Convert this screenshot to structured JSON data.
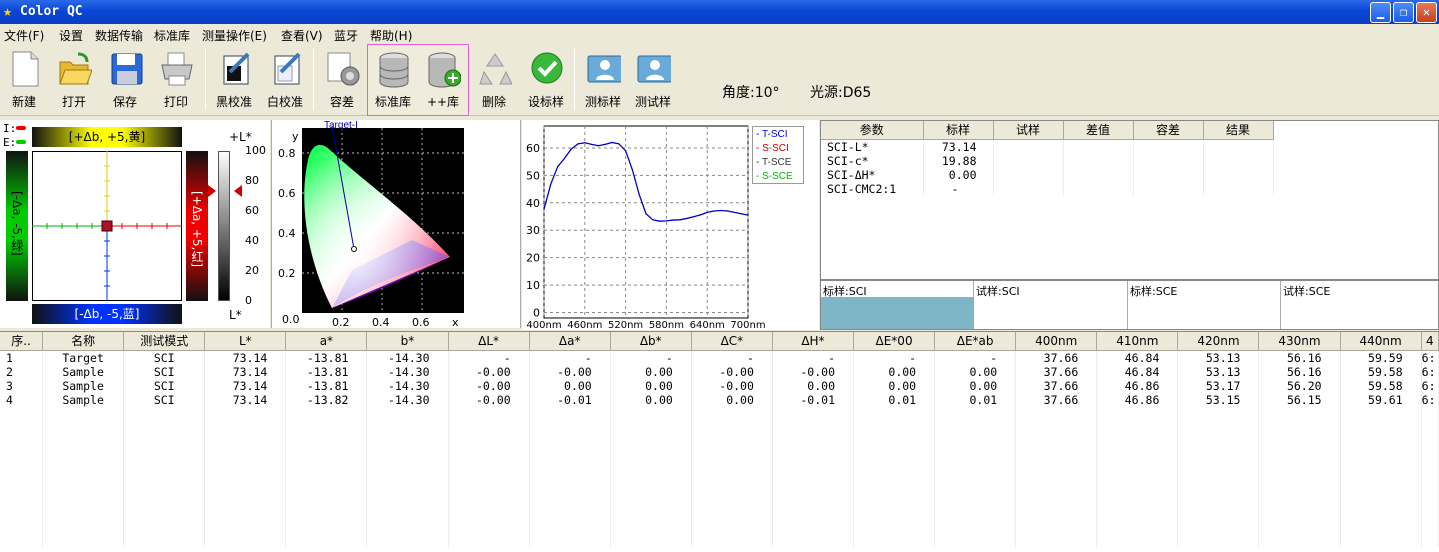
{
  "window": {
    "title": "Color QC"
  },
  "menu": [
    "文件(F)",
    "设置",
    "数据传输",
    "标准库",
    "测量操作(E)",
    "查看(V)",
    "蓝牙",
    "帮助(H)"
  ],
  "toolbar": {
    "new": "新建",
    "open": "打开",
    "save": "保存",
    "print": "打印",
    "black_cal": "黑校准",
    "white_cal": "白校准",
    "tolerance": "容差",
    "std_lib": "标准库",
    "add_lib": "++库",
    "delete": "删除",
    "set_std": "设标样",
    "measure_std": "测标样",
    "measure_trial": "测试样",
    "angle": "角度:10°",
    "light": "光源:D65"
  },
  "ab_panel": {
    "legend_i": "I:",
    "legend_e": "E:",
    "top_label": "[+Δb, +5,黄]",
    "bottom_label": "[-Δb, -5,蓝]",
    "left_label": "[-Δa, -5,绿]",
    "right_label": "[+Δa, +5,红]",
    "l_top": "+L*",
    "l_bottom": "L*",
    "l_ticks": [
      "100",
      "80",
      "60",
      "40",
      "20",
      "0"
    ],
    "marker_l": 73.14
  },
  "cie_panel": {
    "target_label": "Target-I",
    "y_axis": "y",
    "x_axis": "x",
    "y_ticks": [
      "0.8",
      "0.6",
      "0.4",
      "0.2"
    ],
    "x_ticks": [
      "0.0",
      "0.2",
      "0.4",
      "0.6"
    ]
  },
  "spectrum": {
    "legend": [
      {
        "name": "T-SCI",
        "color": "#0000cc"
      },
      {
        "name": "S-SCI",
        "color": "#cc0000"
      },
      {
        "name": "T-SCE",
        "color": "#333333"
      },
      {
        "name": "S-SCE",
        "color": "#00bb00"
      }
    ]
  },
  "chart_data": {
    "type": "line",
    "x": [
      400,
      410,
      420,
      430,
      440,
      450,
      460,
      470,
      480,
      490,
      500,
      510,
      520,
      530,
      540,
      550,
      560,
      570,
      580,
      590,
      600,
      610,
      620,
      630,
      640,
      650,
      660,
      670,
      680,
      690,
      700
    ],
    "series": [
      {
        "name": "T-SCI",
        "values": [
          37.66,
          46.84,
          53.13,
          56.16,
          59.59,
          61.5,
          61.9,
          61.3,
          60.8,
          61.3,
          62.0,
          61.5,
          59.0,
          52.0,
          43.0,
          36.0,
          33.8,
          33.3,
          33.4,
          33.7,
          33.8,
          34.3,
          34.9,
          35.6,
          36.5,
          37.0,
          37.2,
          37.0,
          36.5,
          36.0,
          35.5
        ]
      }
    ],
    "xticks": [
      "400nm",
      "460nm",
      "520nm",
      "580nm",
      "640nm",
      "700nm"
    ],
    "yticks": [
      "0",
      "10",
      "20",
      "30",
      "40",
      "50",
      "60"
    ],
    "ylim": [
      -2,
      68
    ],
    "xlim": [
      400,
      700
    ]
  },
  "result_table": {
    "headers": [
      "参数",
      "标样",
      "试样",
      "差值",
      "容差",
      "结果"
    ],
    "rows": [
      [
        "SCI-L*",
        "73.14"
      ],
      [
        "SCI-c*",
        "19.88"
      ],
      [
        "SCI-ΔH*",
        "0.00"
      ],
      [
        "SCI-CMC2:1",
        "-"
      ]
    ]
  },
  "swatches": [
    {
      "label": "标样:SCI",
      "color": "#7fb6c7"
    },
    {
      "label": "试样:SCI",
      "color": "#ffffff"
    },
    {
      "label": "标样:SCE",
      "color": "#ffffff"
    },
    {
      "label": "试样:SCE",
      "color": "#ffffff"
    }
  ],
  "data_table": {
    "headers": [
      "序..",
      "名称",
      "测试模式",
      "L*",
      "a*",
      "b*",
      "ΔL*",
      "Δa*",
      "Δb*",
      "ΔC*",
      "ΔH*",
      "ΔE*00",
      "ΔE*ab",
      "400nm",
      "410nm",
      "420nm",
      "430nm",
      "440nm",
      "4"
    ],
    "rows": [
      [
        "1",
        "Target",
        "SCI",
        "73.14",
        "-13.81",
        "-14.30",
        "-",
        "-",
        "-",
        "-",
        "-",
        "-",
        "-",
        "37.66",
        "46.84",
        "53.13",
        "56.16",
        "59.59",
        "6:"
      ],
      [
        "2",
        "Sample",
        "SCI",
        "73.14",
        "-13.81",
        "-14.30",
        "-0.00",
        "-0.00",
        "0.00",
        "-0.00",
        "-0.00",
        "0.00",
        "0.00",
        "37.66",
        "46.84",
        "53.13",
        "56.16",
        "59.58",
        "6:"
      ],
      [
        "3",
        "Sample",
        "SCI",
        "73.14",
        "-13.81",
        "-14.30",
        "-0.00",
        "0.00",
        "0.00",
        "-0.00",
        "0.00",
        "0.00",
        "0.00",
        "37.66",
        "46.86",
        "53.17",
        "56.20",
        "59.58",
        "6:"
      ],
      [
        "4",
        "Sample",
        "SCI",
        "73.14",
        "-13.82",
        "-14.30",
        "-0.00",
        "-0.01",
        "0.00",
        "0.00",
        "-0.01",
        "0.01",
        "0.01",
        "37.66",
        "46.86",
        "53.15",
        "56.15",
        "59.61",
        "6:"
      ]
    ]
  }
}
